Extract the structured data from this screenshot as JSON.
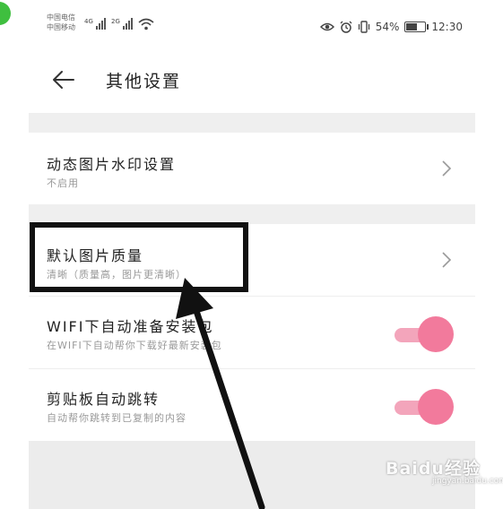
{
  "status_bar": {
    "carrier1": "中国电信",
    "carrier2": "中国移动",
    "net1": "4G",
    "net2": "2G",
    "battery": "54%",
    "time": "12:30"
  },
  "header": {
    "title": "其他设置"
  },
  "settings": [
    {
      "label": "动态图片水印设置",
      "sub": "不启用"
    },
    {
      "label": "默认图片质量",
      "sub": "清晰（质量高，图片更清晰）"
    },
    {
      "label": "WIFI下自动准备安装包",
      "sub": "在WIFI下自动帮你下载好最新安装包",
      "toggle_on": true
    },
    {
      "label": "剪贴板自动跳转",
      "sub": "自动帮你跳转到已复制的内容",
      "toggle_on": true
    }
  ],
  "colors": {
    "toggle_knob": "#f27a9c",
    "toggle_track": "#f3a5bb",
    "highlight": "#111111"
  },
  "watermark": {
    "text": "Baidu经验",
    "sub": "jingyan.baidu.com"
  }
}
